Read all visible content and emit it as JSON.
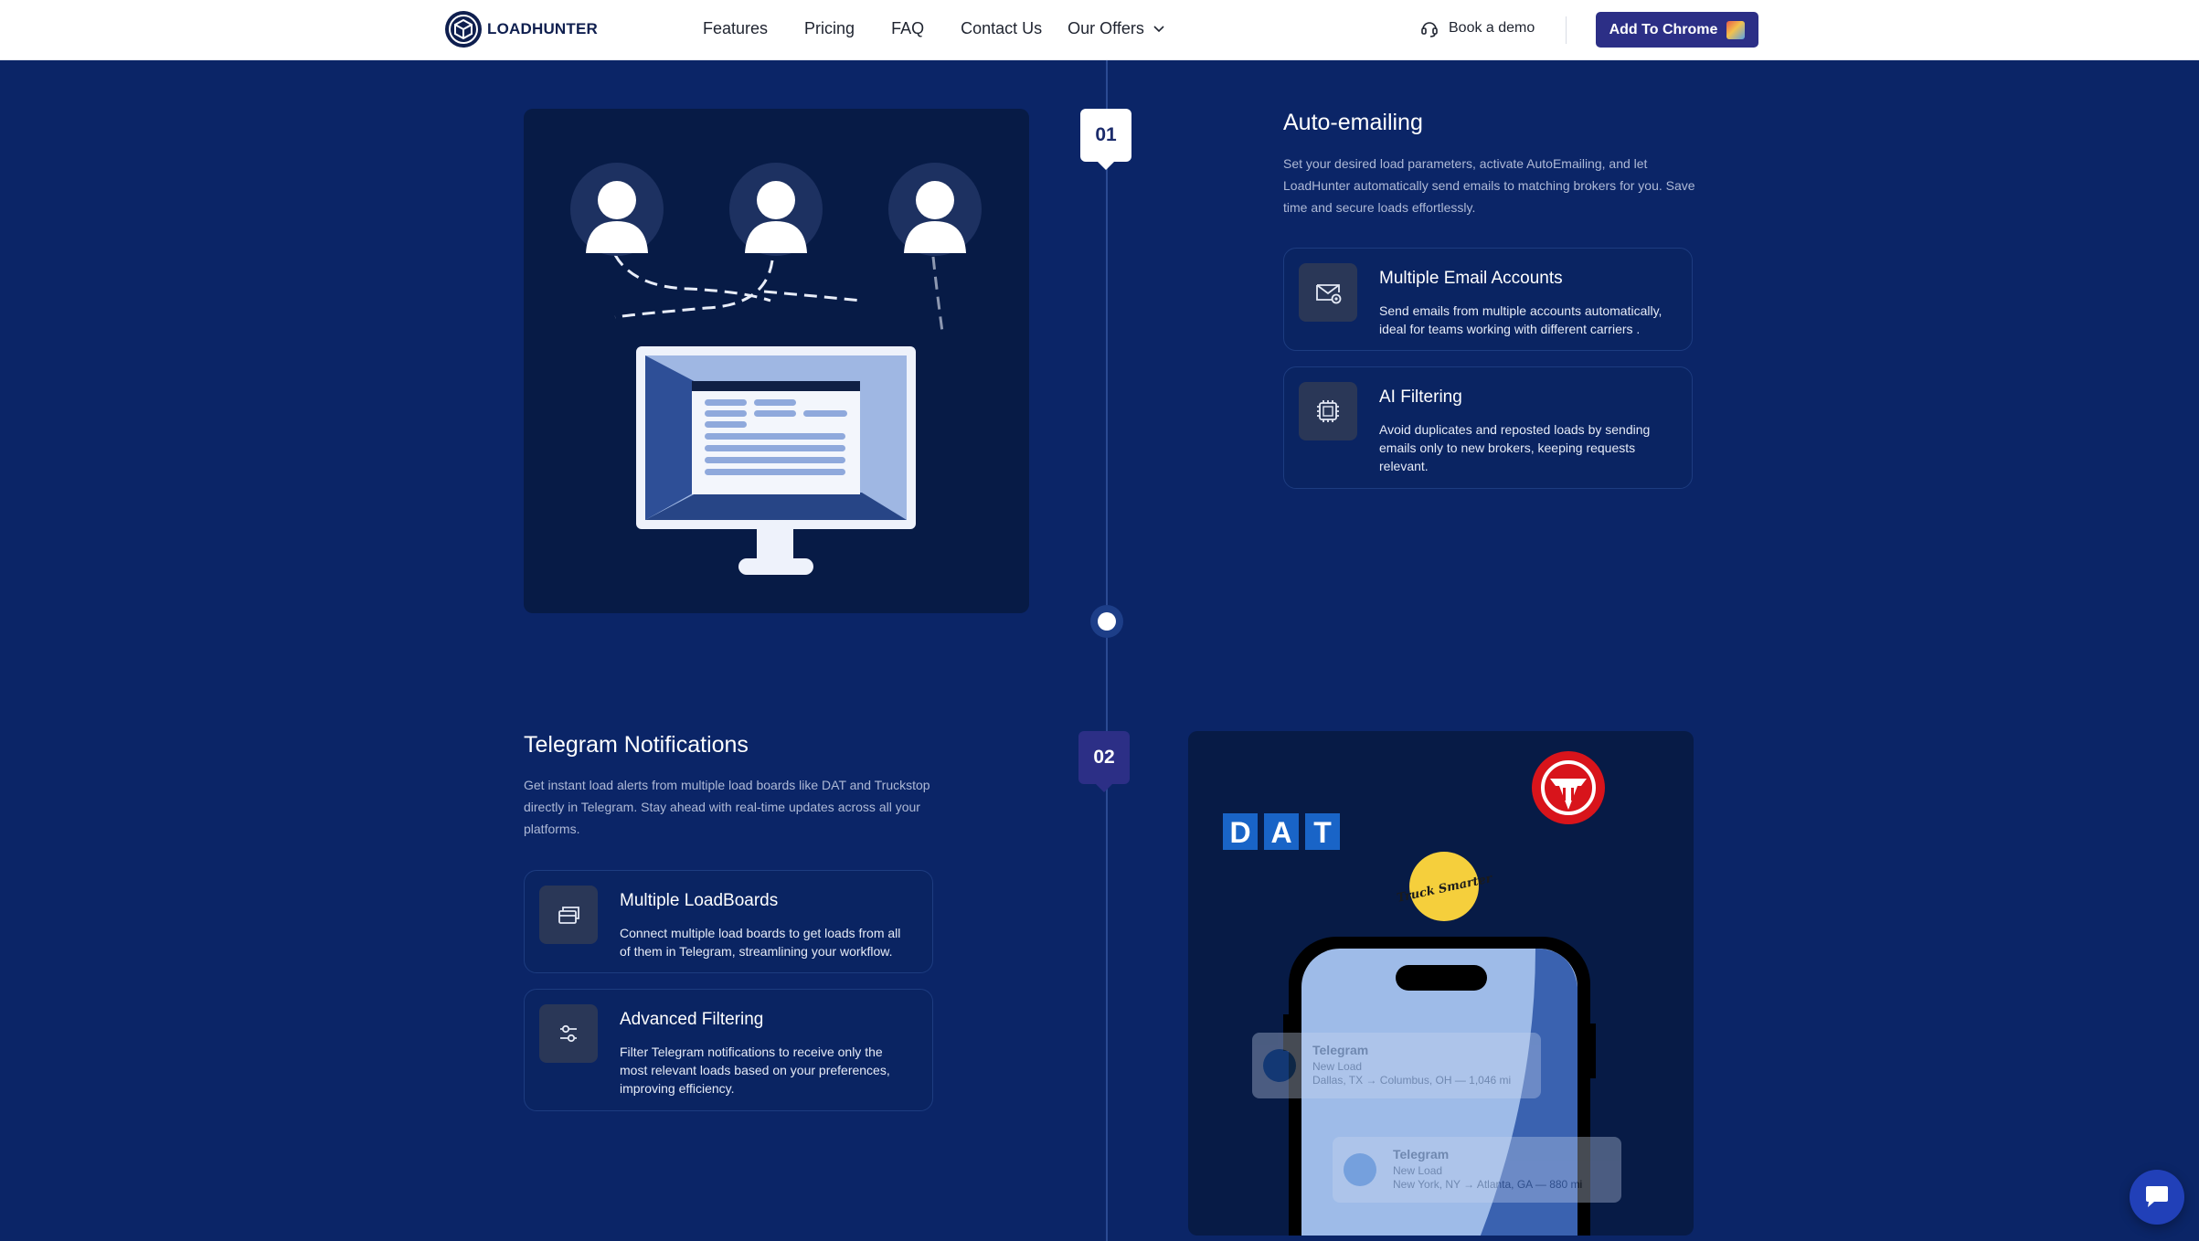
{
  "header": {
    "logo_text": "LOADHUNTER",
    "nav": [
      {
        "label": "Features"
      },
      {
        "label": "Pricing"
      },
      {
        "label": "FAQ"
      },
      {
        "label": "Contact Us"
      },
      {
        "label": "Our Offers"
      }
    ],
    "demo_label": "Book a demo",
    "cta_label": "Add To Chrome"
  },
  "sections": [
    {
      "step": "01",
      "title": "Auto-emailing",
      "description": "Set your desired load parameters, activate AutoEmailing, and let LoadHunter automatically send emails to matching brokers for you. Save time and secure loads effortlessly.",
      "features": [
        {
          "icon": "email-at-icon",
          "title": "Multiple Email Accounts",
          "description": "Send emails from multiple accounts automatically, ideal for teams working with different carriers ."
        },
        {
          "icon": "ai-chip-icon",
          "title": "AI Filtering",
          "description": "Avoid duplicates and reposted loads by sending emails only to new brokers, keeping requests relevant."
        }
      ]
    },
    {
      "step": "02",
      "title": "Telegram Notifications",
      "description": "Get instant load alerts from multiple load boards like DAT and Truckstop directly in Telegram. Stay ahead with real-time updates across all your platforms.",
      "features": [
        {
          "icon": "cards-icon",
          "title": "Multiple LoadBoards",
          "description": "Connect multiple load boards to get loads from all of them in Telegram, streamlining your workflow."
        },
        {
          "icon": "sliders-icon",
          "title": "Advanced Filtering",
          "description": "Filter Telegram notifications to receive only the most relevant loads based on your preferences, improving efficiency."
        }
      ]
    }
  ],
  "illustration_2": {
    "dat_letters": [
      "D",
      "A",
      "T"
    ],
    "truck_smarter_logo": "Truck Smarter",
    "notifications": [
      {
        "app": "Telegram",
        "line1": "New Load",
        "line2": "Dallas, TX → Columbus, OH — 1,046 mi"
      },
      {
        "app": "Telegram",
        "line1": "New Load",
        "line2": "New York, NY → Atlanta, GA — 880 mi"
      }
    ]
  },
  "colors": {
    "page_bg": "#0b2567",
    "card_bg": "#071b46",
    "accent": "#2c2f86",
    "dat_blue": "#1964c7",
    "truckstop_red": "#d8141b",
    "truck_smarter_yellow": "#f5cf3c"
  }
}
